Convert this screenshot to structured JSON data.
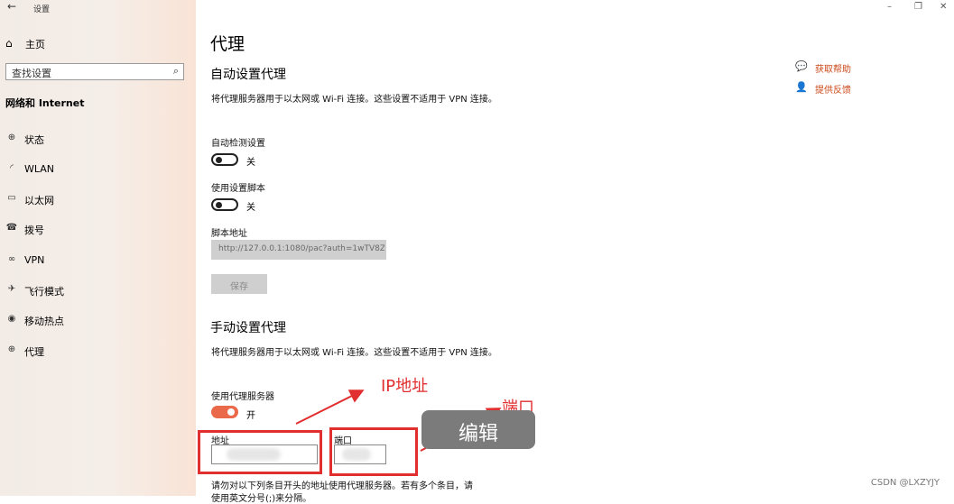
{
  "window": {
    "back_glyph": "←",
    "title": "设置",
    "minimize_glyph": "–",
    "maximize_glyph": "❐",
    "close_glyph": "✕"
  },
  "sidebar": {
    "home_label": "主页",
    "search_placeholder": "查找设置",
    "category": "网络和 Internet",
    "items": [
      {
        "label": "状态",
        "icon": "globe-status-icon",
        "glyph": "⊕"
      },
      {
        "label": "WLAN",
        "icon": "wifi-icon",
        "glyph": "◜"
      },
      {
        "label": "以太网",
        "icon": "ethernet-icon",
        "glyph": "▭"
      },
      {
        "label": "拨号",
        "icon": "dialup-icon",
        "glyph": "☎"
      },
      {
        "label": "VPN",
        "icon": "vpn-icon",
        "glyph": "∞"
      },
      {
        "label": "飞行模式",
        "icon": "airplane-icon",
        "glyph": "✈"
      },
      {
        "label": "移动热点",
        "icon": "hotspot-icon",
        "glyph": "◉"
      },
      {
        "label": "代理",
        "icon": "proxy-icon",
        "glyph": "⊕"
      }
    ]
  },
  "main": {
    "title": "代理",
    "auto_section": {
      "heading": "自动设置代理",
      "description": "将代理服务器用于以太网或 Wi-Fi 连接。这些设置不适用于 VPN 连接。",
      "auto_detect_label": "自动检测设置",
      "auto_detect_state": "关",
      "script_label": "使用设置脚本",
      "script_state": "关",
      "script_address_label": "脚本地址",
      "script_address_value": "http://127.0.0.1:1080/pac?auth=1wTV8Z",
      "save_label": "保存"
    },
    "manual_section": {
      "heading": "手动设置代理",
      "description": "将代理服务器用于以太网或 Wi-Fi 连接。这些设置不适用于 VPN 连接。",
      "use_proxy_label": "使用代理服务器",
      "use_proxy_state": "开",
      "address_label": "地址",
      "port_label": "端口",
      "exceptions_text_line1": "请勿对以下列条目开头的地址使用代理服务器。若有多个条目，请",
      "exceptions_text_line2": "使用英文分号(;)来分隔。"
    }
  },
  "help": {
    "get_help": "获取帮助",
    "feedback": "提供反馈"
  },
  "annotations": {
    "ip_label": "IP地址",
    "port_label": "端口",
    "edit_label": "编辑",
    "color": "#e12e2e"
  },
  "watermark": "CSDN @LXZYJY",
  "colors": {
    "toggle_on": "#e9694a",
    "link": "#cc4a1c"
  }
}
